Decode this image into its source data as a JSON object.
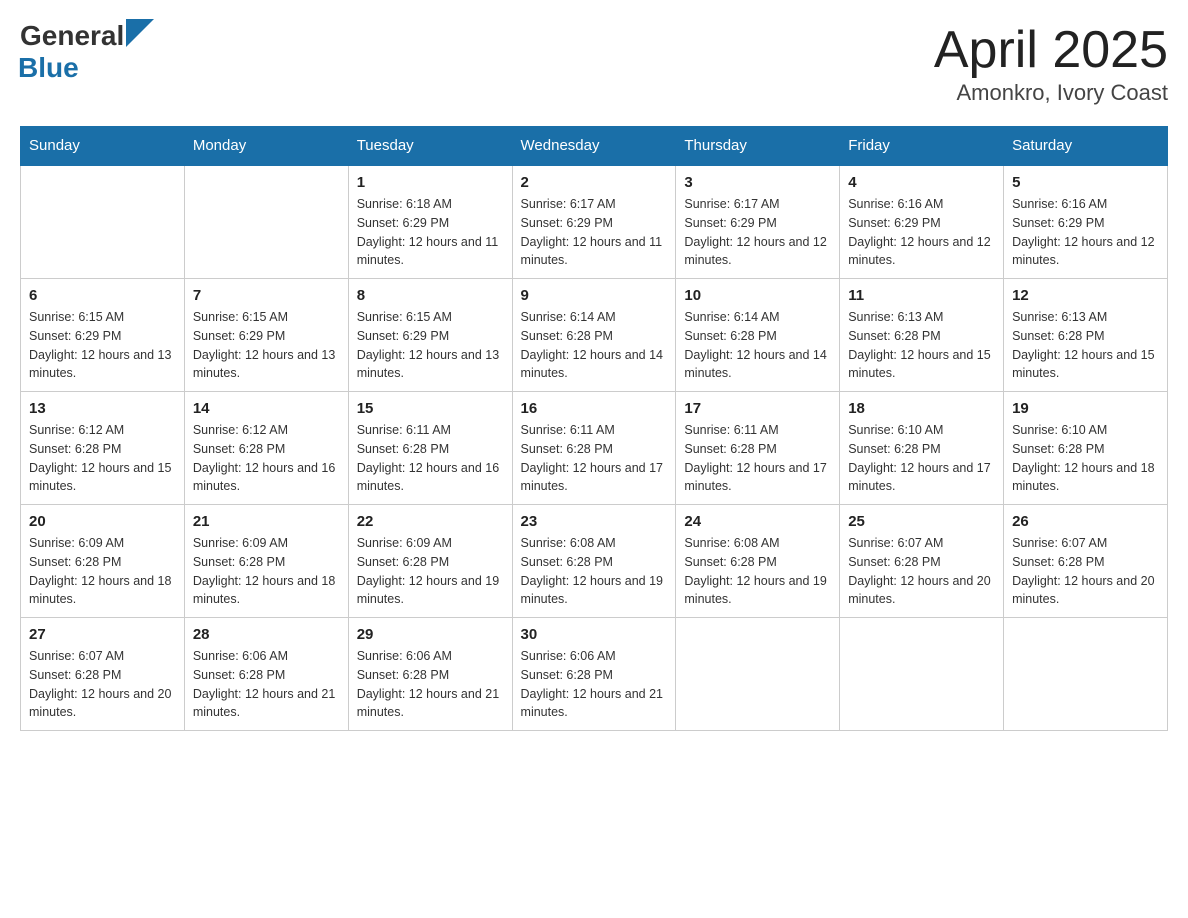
{
  "header": {
    "logo_general": "General",
    "logo_blue": "Blue",
    "month_title": "April 2025",
    "location": "Amonkro, Ivory Coast"
  },
  "days_of_week": [
    "Sunday",
    "Monday",
    "Tuesday",
    "Wednesday",
    "Thursday",
    "Friday",
    "Saturday"
  ],
  "weeks": [
    [
      {
        "day": "",
        "sunrise": "",
        "sunset": "",
        "daylight": ""
      },
      {
        "day": "",
        "sunrise": "",
        "sunset": "",
        "daylight": ""
      },
      {
        "day": "1",
        "sunrise": "Sunrise: 6:18 AM",
        "sunset": "Sunset: 6:29 PM",
        "daylight": "Daylight: 12 hours and 11 minutes."
      },
      {
        "day": "2",
        "sunrise": "Sunrise: 6:17 AM",
        "sunset": "Sunset: 6:29 PM",
        "daylight": "Daylight: 12 hours and 11 minutes."
      },
      {
        "day": "3",
        "sunrise": "Sunrise: 6:17 AM",
        "sunset": "Sunset: 6:29 PM",
        "daylight": "Daylight: 12 hours and 12 minutes."
      },
      {
        "day": "4",
        "sunrise": "Sunrise: 6:16 AM",
        "sunset": "Sunset: 6:29 PM",
        "daylight": "Daylight: 12 hours and 12 minutes."
      },
      {
        "day": "5",
        "sunrise": "Sunrise: 6:16 AM",
        "sunset": "Sunset: 6:29 PM",
        "daylight": "Daylight: 12 hours and 12 minutes."
      }
    ],
    [
      {
        "day": "6",
        "sunrise": "Sunrise: 6:15 AM",
        "sunset": "Sunset: 6:29 PM",
        "daylight": "Daylight: 12 hours and 13 minutes."
      },
      {
        "day": "7",
        "sunrise": "Sunrise: 6:15 AM",
        "sunset": "Sunset: 6:29 PM",
        "daylight": "Daylight: 12 hours and 13 minutes."
      },
      {
        "day": "8",
        "sunrise": "Sunrise: 6:15 AM",
        "sunset": "Sunset: 6:29 PM",
        "daylight": "Daylight: 12 hours and 13 minutes."
      },
      {
        "day": "9",
        "sunrise": "Sunrise: 6:14 AM",
        "sunset": "Sunset: 6:28 PM",
        "daylight": "Daylight: 12 hours and 14 minutes."
      },
      {
        "day": "10",
        "sunrise": "Sunrise: 6:14 AM",
        "sunset": "Sunset: 6:28 PM",
        "daylight": "Daylight: 12 hours and 14 minutes."
      },
      {
        "day": "11",
        "sunrise": "Sunrise: 6:13 AM",
        "sunset": "Sunset: 6:28 PM",
        "daylight": "Daylight: 12 hours and 15 minutes."
      },
      {
        "day": "12",
        "sunrise": "Sunrise: 6:13 AM",
        "sunset": "Sunset: 6:28 PM",
        "daylight": "Daylight: 12 hours and 15 minutes."
      }
    ],
    [
      {
        "day": "13",
        "sunrise": "Sunrise: 6:12 AM",
        "sunset": "Sunset: 6:28 PM",
        "daylight": "Daylight: 12 hours and 15 minutes."
      },
      {
        "day": "14",
        "sunrise": "Sunrise: 6:12 AM",
        "sunset": "Sunset: 6:28 PM",
        "daylight": "Daylight: 12 hours and 16 minutes."
      },
      {
        "day": "15",
        "sunrise": "Sunrise: 6:11 AM",
        "sunset": "Sunset: 6:28 PM",
        "daylight": "Daylight: 12 hours and 16 minutes."
      },
      {
        "day": "16",
        "sunrise": "Sunrise: 6:11 AM",
        "sunset": "Sunset: 6:28 PM",
        "daylight": "Daylight: 12 hours and 17 minutes."
      },
      {
        "day": "17",
        "sunrise": "Sunrise: 6:11 AM",
        "sunset": "Sunset: 6:28 PM",
        "daylight": "Daylight: 12 hours and 17 minutes."
      },
      {
        "day": "18",
        "sunrise": "Sunrise: 6:10 AM",
        "sunset": "Sunset: 6:28 PM",
        "daylight": "Daylight: 12 hours and 17 minutes."
      },
      {
        "day": "19",
        "sunrise": "Sunrise: 6:10 AM",
        "sunset": "Sunset: 6:28 PM",
        "daylight": "Daylight: 12 hours and 18 minutes."
      }
    ],
    [
      {
        "day": "20",
        "sunrise": "Sunrise: 6:09 AM",
        "sunset": "Sunset: 6:28 PM",
        "daylight": "Daylight: 12 hours and 18 minutes."
      },
      {
        "day": "21",
        "sunrise": "Sunrise: 6:09 AM",
        "sunset": "Sunset: 6:28 PM",
        "daylight": "Daylight: 12 hours and 18 minutes."
      },
      {
        "day": "22",
        "sunrise": "Sunrise: 6:09 AM",
        "sunset": "Sunset: 6:28 PM",
        "daylight": "Daylight: 12 hours and 19 minutes."
      },
      {
        "day": "23",
        "sunrise": "Sunrise: 6:08 AM",
        "sunset": "Sunset: 6:28 PM",
        "daylight": "Daylight: 12 hours and 19 minutes."
      },
      {
        "day": "24",
        "sunrise": "Sunrise: 6:08 AM",
        "sunset": "Sunset: 6:28 PM",
        "daylight": "Daylight: 12 hours and 19 minutes."
      },
      {
        "day": "25",
        "sunrise": "Sunrise: 6:07 AM",
        "sunset": "Sunset: 6:28 PM",
        "daylight": "Daylight: 12 hours and 20 minutes."
      },
      {
        "day": "26",
        "sunrise": "Sunrise: 6:07 AM",
        "sunset": "Sunset: 6:28 PM",
        "daylight": "Daylight: 12 hours and 20 minutes."
      }
    ],
    [
      {
        "day": "27",
        "sunrise": "Sunrise: 6:07 AM",
        "sunset": "Sunset: 6:28 PM",
        "daylight": "Daylight: 12 hours and 20 minutes."
      },
      {
        "day": "28",
        "sunrise": "Sunrise: 6:06 AM",
        "sunset": "Sunset: 6:28 PM",
        "daylight": "Daylight: 12 hours and 21 minutes."
      },
      {
        "day": "29",
        "sunrise": "Sunrise: 6:06 AM",
        "sunset": "Sunset: 6:28 PM",
        "daylight": "Daylight: 12 hours and 21 minutes."
      },
      {
        "day": "30",
        "sunrise": "Sunrise: 6:06 AM",
        "sunset": "Sunset: 6:28 PM",
        "daylight": "Daylight: 12 hours and 21 minutes."
      },
      {
        "day": "",
        "sunrise": "",
        "sunset": "",
        "daylight": ""
      },
      {
        "day": "",
        "sunrise": "",
        "sunset": "",
        "daylight": ""
      },
      {
        "day": "",
        "sunrise": "",
        "sunset": "",
        "daylight": ""
      }
    ]
  ]
}
